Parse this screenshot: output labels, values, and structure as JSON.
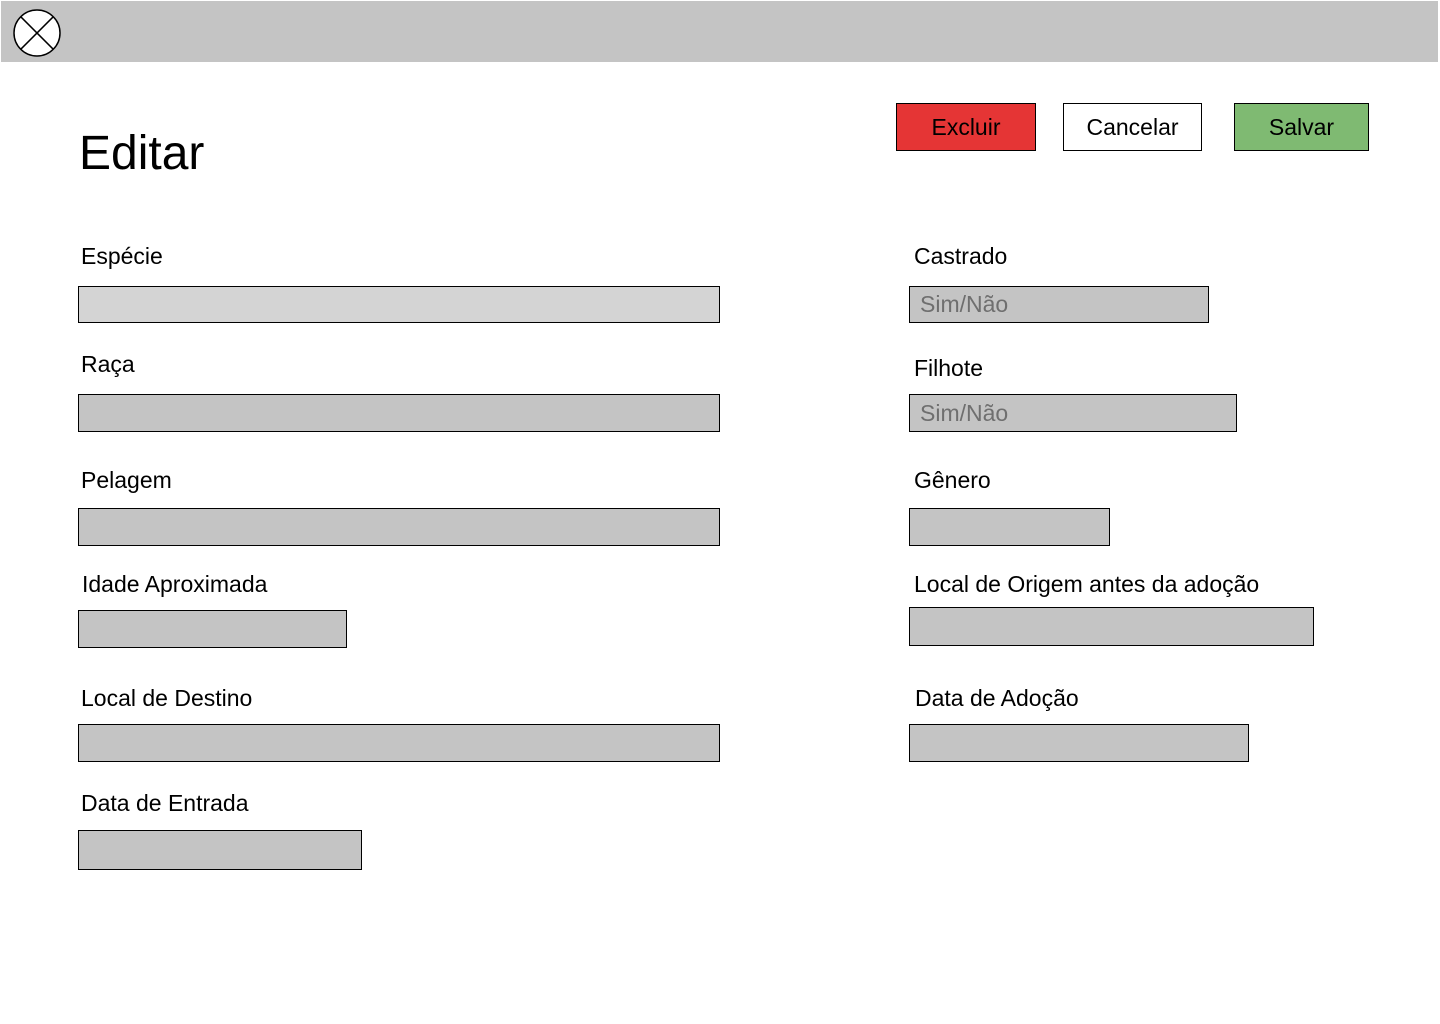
{
  "colors": {
    "topbar": "#c4c4c4",
    "field": "#c4c4c4",
    "excluir": "#e53535",
    "salvar": "#7fba72",
    "cancelar": "#ffffff"
  },
  "header": {
    "logo_icon": "circle-x-icon"
  },
  "page": {
    "title": "Editar"
  },
  "actions": {
    "excluir": "Excluir",
    "cancelar": "Cancelar",
    "salvar": "Salvar"
  },
  "form": {
    "left": {
      "especie": {
        "label": "Espécie",
        "value": ""
      },
      "raca": {
        "label": "Raça",
        "value": ""
      },
      "pelagem": {
        "label": "Pelagem",
        "value": ""
      },
      "idade": {
        "label": "Idade Aproximada",
        "value": ""
      },
      "destino": {
        "label": "Local de Destino",
        "value": ""
      },
      "entrada": {
        "label": "Data de Entrada",
        "value": ""
      }
    },
    "right": {
      "castrado": {
        "label": "Castrado",
        "value": "",
        "placeholder": "Sim/Não"
      },
      "filhote": {
        "label": "Filhote",
        "value": "",
        "placeholder": "Sim/Não"
      },
      "genero": {
        "label": "Gênero",
        "value": ""
      },
      "origem": {
        "label": "Local de Origem antes da adoção",
        "value": ""
      },
      "adocao": {
        "label": "Data de Adoção",
        "value": ""
      }
    }
  }
}
